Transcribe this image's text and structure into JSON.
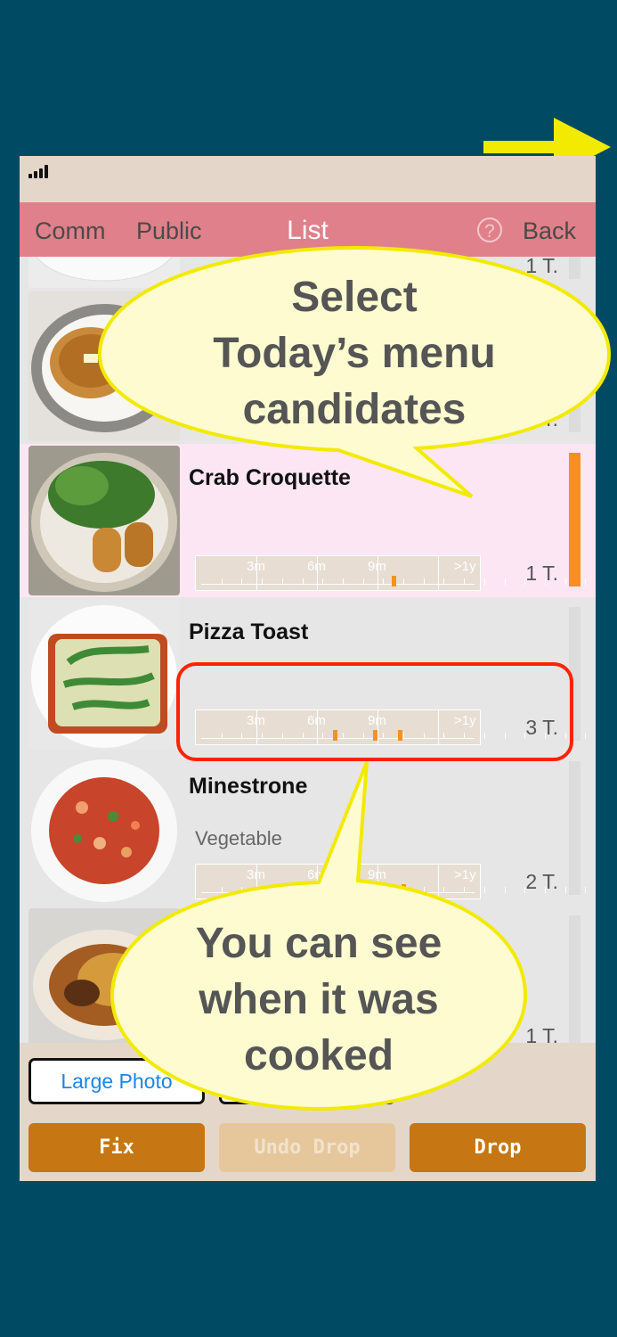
{
  "nav": {
    "left1": "Comm",
    "left2": "Public",
    "title": "List",
    "right": "Back",
    "help": "?"
  },
  "rows": [
    {
      "name": "",
      "count": "1 T."
    },
    {
      "name": "",
      "count": "1 T."
    },
    {
      "name": "Crab Croquette",
      "category": "",
      "count": "1 T.",
      "selected": true,
      "marks_months": [
        9.7
      ]
    },
    {
      "name": "Pizza Toast",
      "category": "",
      "count": "3 T.",
      "marks_months": [
        6.8,
        8.8,
        10.0
      ]
    },
    {
      "name": "Minestrone",
      "category": "Vegetable",
      "count": "2 T.",
      "marks_months": [
        10.2
      ]
    },
    {
      "name": "",
      "count": "1 T."
    }
  ],
  "timeline_labels": [
    "3m",
    "6m",
    "9m",
    ">1y"
  ],
  "buttons": {
    "large_photo": "Large Photo",
    "fix": "Fix",
    "undo_drop": "Undo Drop",
    "drop": "Drop"
  },
  "callouts": {
    "top": [
      "Select",
      "Today’s menu",
      "candidates"
    ],
    "bottom": [
      "You can see",
      "when it was",
      "cooked"
    ]
  },
  "colors": {
    "background": "#004b63",
    "nav": "#e0808a",
    "accent": "#f5921e",
    "button": "#c67612",
    "selected_row": "#fde6f3",
    "callout_fill": "#fffbd0",
    "callout_stroke": "#f2ea00",
    "highlight": "#ff2200",
    "arrow": "#f2ea00"
  }
}
